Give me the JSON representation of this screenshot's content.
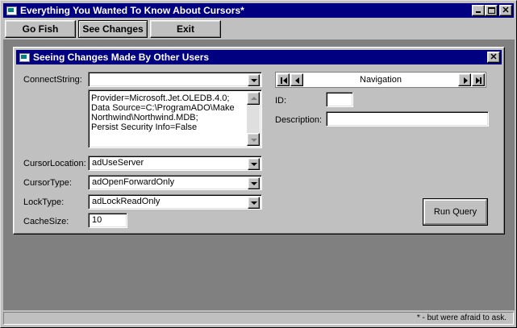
{
  "window": {
    "title": "Everything You Wanted To Know About Cursors*"
  },
  "menu": {
    "items": [
      {
        "label": "Go Fish"
      },
      {
        "label": "See Changes"
      },
      {
        "label": "Exit"
      }
    ]
  },
  "child": {
    "title": "Seeing Changes Made By Other Users",
    "connect": {
      "label": "ConnectString:",
      "value": "",
      "text_lines": [
        "Provider=Microsoft.Jet.OLEDB.4.0;",
        "Data Source=C:\\ProgramADO\\Make",
        "Northwind\\Northwind.MDB;",
        "Persist Security Info=False"
      ]
    },
    "cursor_location": {
      "label": "CursorLocation:",
      "value": "adUseServer"
    },
    "cursor_type": {
      "label": "CursorType:",
      "value": "adOpenForwardOnly"
    },
    "lock_type": {
      "label": "LockType:",
      "value": "adLockReadOnly"
    },
    "cache_size": {
      "label": "CacheSize:",
      "value": "10"
    },
    "navigation": {
      "caption": "Navigation"
    },
    "id": {
      "label": "ID:",
      "value": ""
    },
    "description": {
      "label": "Description:",
      "value": ""
    },
    "run_query": {
      "label": "Run Query"
    }
  },
  "status": {
    "text": "* - but were afraid to ask."
  },
  "colors": {
    "titlebar": "#000080",
    "face": "#c0c0c0",
    "mdi_background": "#808080"
  }
}
